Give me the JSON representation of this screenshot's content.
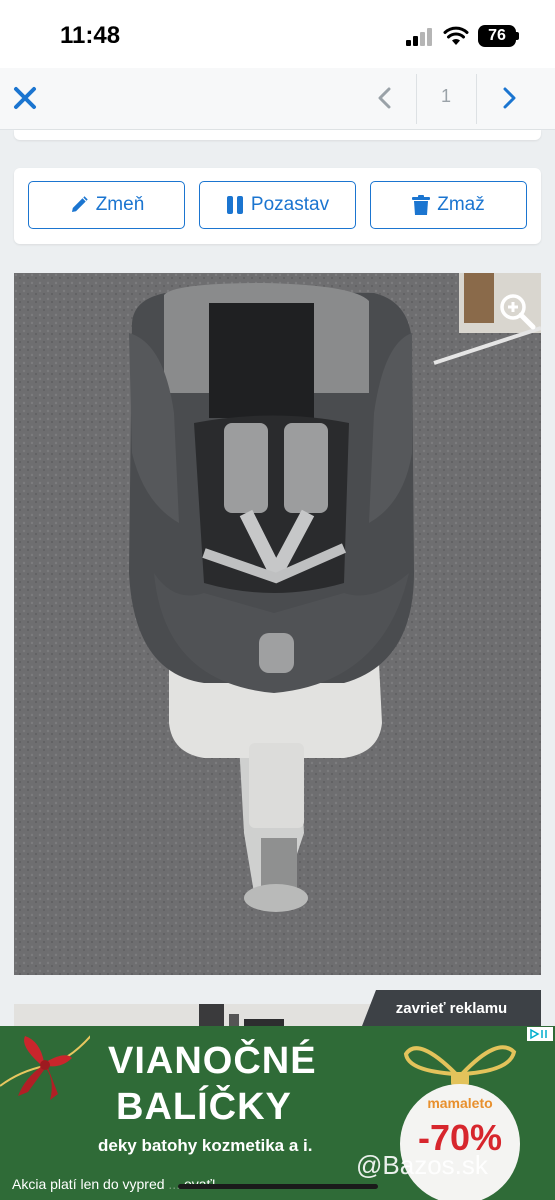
{
  "status_bar": {
    "time": "11:48",
    "battery": "76"
  },
  "nav": {
    "page_number": "1"
  },
  "actions": {
    "edit_label": "Zmeň",
    "pause_label": "Pozastav",
    "delete_label": "Zmaž"
  },
  "ad": {
    "close_label": "zavrieť reklamu",
    "title_line1": "VIANOČNÉ",
    "title_line2": "BALÍČKY",
    "subtitle": "deky batohy kozmetika a i.",
    "footnote": "Akcia platí len do vypred",
    "footnote_tail": "ovať!",
    "brand": "mamaleto",
    "discount": "-70%"
  },
  "watermark": "@Bazos.sk",
  "colors": {
    "accent": "#1b75d0",
    "ad_green": "#2f6b37",
    "ad_red": "#d7262d",
    "close_ad_bg": "#3d4146"
  }
}
